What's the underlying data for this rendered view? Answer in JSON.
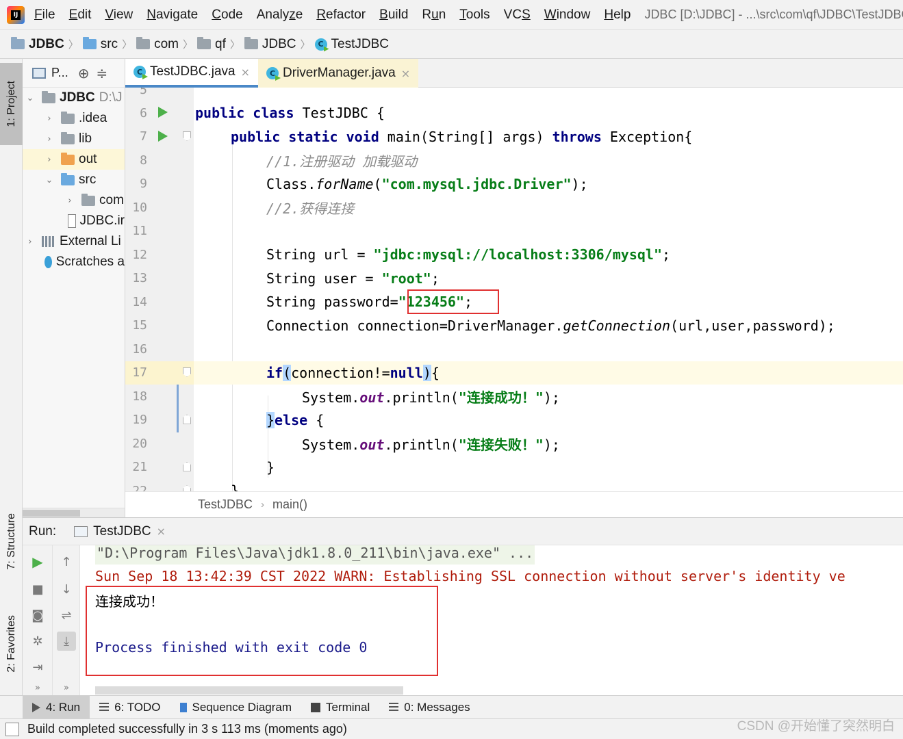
{
  "menubar": {
    "items": [
      "File",
      "Edit",
      "View",
      "Navigate",
      "Code",
      "Analyze",
      "Refactor",
      "Build",
      "Run",
      "Tools",
      "VCS",
      "Window",
      "Help"
    ],
    "mnemonics": [
      "F",
      "E",
      "V",
      "N",
      "C",
      "z",
      "R",
      "B",
      "u",
      "T",
      "S",
      "W",
      "H"
    ],
    "window_title": "JDBC [D:\\JDBC] - ...\\src\\com\\qf\\JDBC\\TestJDBC"
  },
  "navbar": {
    "crumbs": [
      {
        "label": "JDBC",
        "icon": "project-folder-icon"
      },
      {
        "label": "src",
        "icon": "source-folder-icon"
      },
      {
        "label": "com",
        "icon": "package-icon"
      },
      {
        "label": "qf",
        "icon": "package-icon"
      },
      {
        "label": "JDBC",
        "icon": "package-icon"
      },
      {
        "label": "TestJDBC",
        "icon": "class-icon"
      }
    ]
  },
  "left_strip": {
    "project_tab": "1: Project",
    "structure_tab": "7: Structure",
    "favorites_tab": "2: Favorites"
  },
  "project_panel": {
    "title": "P...",
    "tree": [
      {
        "label": "JDBC",
        "suffix": "D:\\J",
        "expanded": true
      },
      {
        "label": ".idea"
      },
      {
        "label": "lib"
      },
      {
        "label": "out"
      },
      {
        "label": "src",
        "expanded": true
      },
      {
        "label": "com"
      },
      {
        "label": "JDBC.ir"
      },
      {
        "label": "External Li"
      },
      {
        "label": "Scratches a"
      }
    ]
  },
  "editor_tabs": [
    {
      "label": "TestJDBC.java",
      "active": true
    },
    {
      "label": "DriverManager.java",
      "active": false
    }
  ],
  "editor": {
    "line_numbers": [
      "5",
      "6",
      "7",
      "8",
      "9",
      "10",
      "11",
      "12",
      "13",
      "14",
      "15",
      "16",
      "17",
      "18",
      "19",
      "20",
      "21",
      "22"
    ],
    "current_line": "17",
    "code": {
      "l6_kw1": "public",
      "l6_kw2": "class",
      "l6_rest": " TestJDBC {",
      "l7_kw": "public static void",
      "l7_mid": " main(String[] args) ",
      "l7_kw2": "throws",
      "l7_rest": " Exception{",
      "l8_comment": "//1.注册驱动 加载驱动",
      "l9_a": "Class.",
      "l9_method": "forName",
      "l9_b": "(",
      "l9_str": "\"com.mysql.jdbc.Driver\"",
      "l9_c": ");",
      "l10_comment": "//2.获得连接",
      "l12_a": "String url = ",
      "l12_str": "\"jdbc:mysql://localhost:3306/mysql\"",
      "l12_c": ";",
      "l13_a": "String user = ",
      "l13_str": "\"root\"",
      "l13_c": ";",
      "l14_a": "String password=",
      "l14_str": "\"123456\"",
      "l14_c": ";",
      "l15_a": "Connection connection=DriverManager.",
      "l15_method": "getConnection",
      "l15_b": "(url,user,password);",
      "l17_kw": "if",
      "l17_open": "(",
      "l17_mid": "connection!=",
      "l17_kw2": "null",
      "l17_close": ")",
      "l17_brace": "{",
      "l18_a": "System.",
      "l18_field": "out",
      "l18_b": ".println(",
      "l18_str": "\"连接成功！\"",
      "l18_c": ");",
      "l19_brace": "}",
      "l19_kw": "else",
      "l19_rest": " {",
      "l20_a": "System.",
      "l20_field": "out",
      "l20_b": ".println(",
      "l20_str": "\"连接失败！\"",
      "l20_c": ");",
      "l21_brace": "}",
      "l22_brace": "}"
    },
    "breadcrumb": [
      "TestJDBC",
      "main()"
    ]
  },
  "run_panel": {
    "label": "Run:",
    "tab": "TestJDBC",
    "console": {
      "cmd": "\"D:\\Program Files\\Java\\jdk1.8.0_211\\bin\\java.exe\" ...",
      "warn": "Sun Sep 18 13:42:39 CST 2022 WARN: Establishing SSL connection without server's identity ve",
      "output": "连接成功！",
      "exit": "Process finished with exit code 0"
    }
  },
  "bottom_tabs": [
    {
      "label": "4: Run",
      "active": true
    },
    {
      "label": "6: TODO"
    },
    {
      "label": "Sequence Diagram"
    },
    {
      "label": "Terminal"
    },
    {
      "label": "0: Messages"
    }
  ],
  "status_bar": {
    "message": "Build completed successfully in 3 s 113 ms (moments ago)"
  },
  "watermark": "CSDN @开始懂了突然明白",
  "colors": {
    "keyword": "#000080",
    "string": "#067d17",
    "comment": "#8c8c8c",
    "highlight_box": "#e03030",
    "console_error": "#b01c0c"
  }
}
